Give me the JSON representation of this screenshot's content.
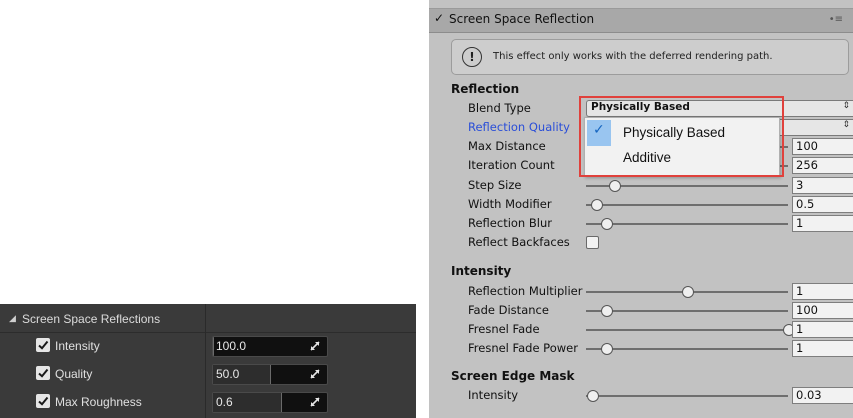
{
  "unreal_panel": {
    "header": {
      "title": "Screen Space Reflections",
      "collapse_icon": "triangle-down-icon"
    },
    "rows": [
      {
        "label": "Intensity",
        "checked": true,
        "value": "100.0",
        "fill_fraction": 0.0
      },
      {
        "label": "Quality",
        "checked": true,
        "value": "50.0",
        "fill_fraction": 0.5
      },
      {
        "label": "Max Roughness",
        "checked": true,
        "value": "0.6",
        "fill_fraction": 0.6
      }
    ]
  },
  "unity_inspector": {
    "component_title": "Screen Space Reflection",
    "enabled": true,
    "notice": "This effect only works with the deferred rendering path.",
    "reflection": {
      "section_label": "Reflection",
      "blend_type": {
        "label": "Blend Type",
        "value": "Physically Based"
      },
      "reflection_quality": {
        "label": "Reflection Quality"
      },
      "max_distance": {
        "label": "Max Distance",
        "value": "100"
      },
      "iteration_count": {
        "label": "Iteration Count",
        "value": "256"
      },
      "step_size": {
        "label": "Step Size",
        "value": "3",
        "slider_fraction": 0.14
      },
      "width_modifier": {
        "label": "Width Modifier",
        "value": "0.5",
        "slider_fraction": 0.05
      },
      "reflection_blur": {
        "label": "Reflection Blur",
        "value": "1",
        "slider_fraction": 0.1
      },
      "reflect_backfaces": {
        "label": "Reflect Backfaces",
        "checked": false
      }
    },
    "intensity": {
      "section_label": "Intensity",
      "reflection_multiplier": {
        "label": "Reflection Multiplier",
        "value": "1",
        "slider_fraction": 0.5
      },
      "fade_distance": {
        "label": "Fade Distance",
        "value": "100",
        "slider_fraction": 0.1
      },
      "fresnel_fade": {
        "label": "Fresnel Fade",
        "value": "1",
        "slider_fraction": 1.0
      },
      "fresnel_fade_power": {
        "label": "Fresnel Fade Power",
        "value": "1",
        "slider_fraction": 0.1
      }
    },
    "screen_edge_mask": {
      "section_label": "Screen Edge Mask",
      "intensity": {
        "label": "Intensity",
        "value": "0.03",
        "slider_fraction": 0.03
      }
    },
    "blend_type_popup": {
      "options": [
        "Physically Based",
        "Additive"
      ],
      "selected": "Physically Based"
    },
    "highlight_color": "#e0413c"
  }
}
